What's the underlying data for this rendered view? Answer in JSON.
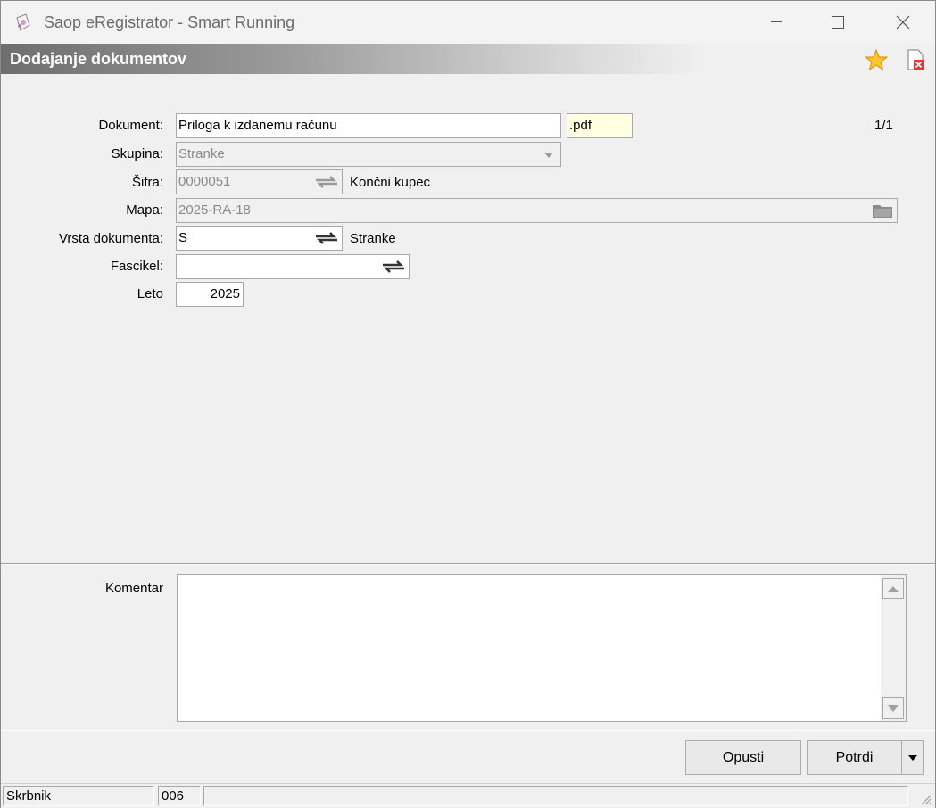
{
  "window": {
    "title": "Saop eRegistrator - Smart Running"
  },
  "header": {
    "title": "Dodajanje dokumentov"
  },
  "form": {
    "dokument": {
      "label": "Dokument:",
      "value": "Priloga k izdanemu računu",
      "ext": ".pdf",
      "page": "1/1"
    },
    "skupina": {
      "label": "Skupina:",
      "value": "Stranke"
    },
    "sifra": {
      "label": "Šifra:",
      "value": "0000051",
      "desc": "Končni kupec"
    },
    "mapa": {
      "label": "Mapa:",
      "value": "2025-RA-18"
    },
    "vrsta": {
      "label": "Vrsta dokumenta:",
      "value": "S",
      "desc": "Stranke"
    },
    "fascikel": {
      "label": "Fascikel:",
      "value": ""
    },
    "leto": {
      "label": "Leto",
      "value": "2025"
    },
    "komentar": {
      "label": "Komentar",
      "value": ""
    }
  },
  "buttons": {
    "cancel_rest": "pusti",
    "cancel_key": "O",
    "confirm_key": "P",
    "confirm_rest": "otrdi"
  },
  "status": {
    "user": "Skrbnik",
    "code": "006"
  },
  "icons": {
    "star": "star-icon",
    "close_doc": "close-document-icon",
    "folder": "folder-icon",
    "swap": "swap-arrows-icon"
  }
}
